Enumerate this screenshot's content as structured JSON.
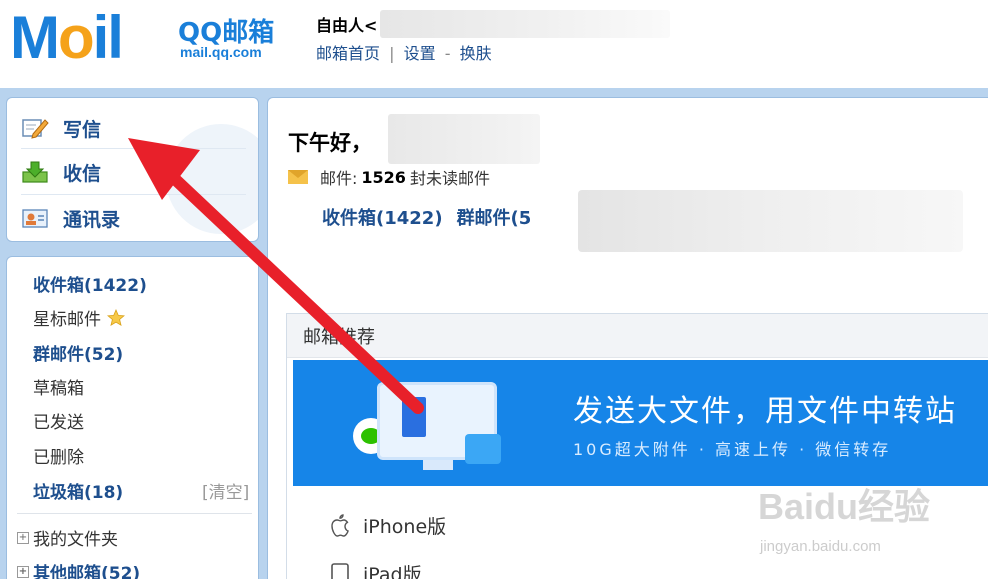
{
  "header": {
    "logo_text_m": "M",
    "logo_text_o": "o",
    "logo_text_il": "il",
    "logo_qq": "QQ邮箱",
    "logo_domain": "mail.qq.com",
    "user_name": "自由人<",
    "links": [
      "邮箱首页",
      "设置",
      "换肤"
    ],
    "sep1": "|",
    "sep2": "-"
  },
  "actions": [
    {
      "label": "写信",
      "icon": "pencil-note-icon"
    },
    {
      "label": "收信",
      "icon": "download-inbox-icon"
    },
    {
      "label": "通讯录",
      "icon": "contacts-card-icon"
    }
  ],
  "folders": {
    "inbox": "收件箱(1422)",
    "starred": "星标邮件",
    "group": "群邮件(52)",
    "drafts": "草稿箱",
    "sent": "已发送",
    "deleted": "已删除",
    "spam": "垃圾箱(18)",
    "spam_clear": "[清空]",
    "my_folders": "我的文件夹",
    "other_mail": "其他邮箱(52)",
    "plus": "+"
  },
  "main": {
    "greeting": "下午好，",
    "mail_label": "邮件:",
    "mail_count": "1526",
    "mail_suffix": "封未读邮件",
    "inbox_link": "收件箱(1422)",
    "group_link": "群邮件(5"
  },
  "recommend": {
    "title": "邮箱推荐",
    "banner_title": "发送大文件，用文件中转站",
    "banner_sub": "10G超大附件 · 高速上传 · 微信转存",
    "platforms": [
      "iPhone版",
      "iPad版"
    ]
  },
  "watermark": {
    "brand": "Baidu经验",
    "url": "jingyan.baidu.com"
  },
  "colors": {
    "brand_blue": "#1a7fd9",
    "link_blue": "#1e4f8e",
    "frame_blue": "#b8d3ee",
    "banner_blue": "#1685e8",
    "arrow_red": "#e8202a"
  }
}
